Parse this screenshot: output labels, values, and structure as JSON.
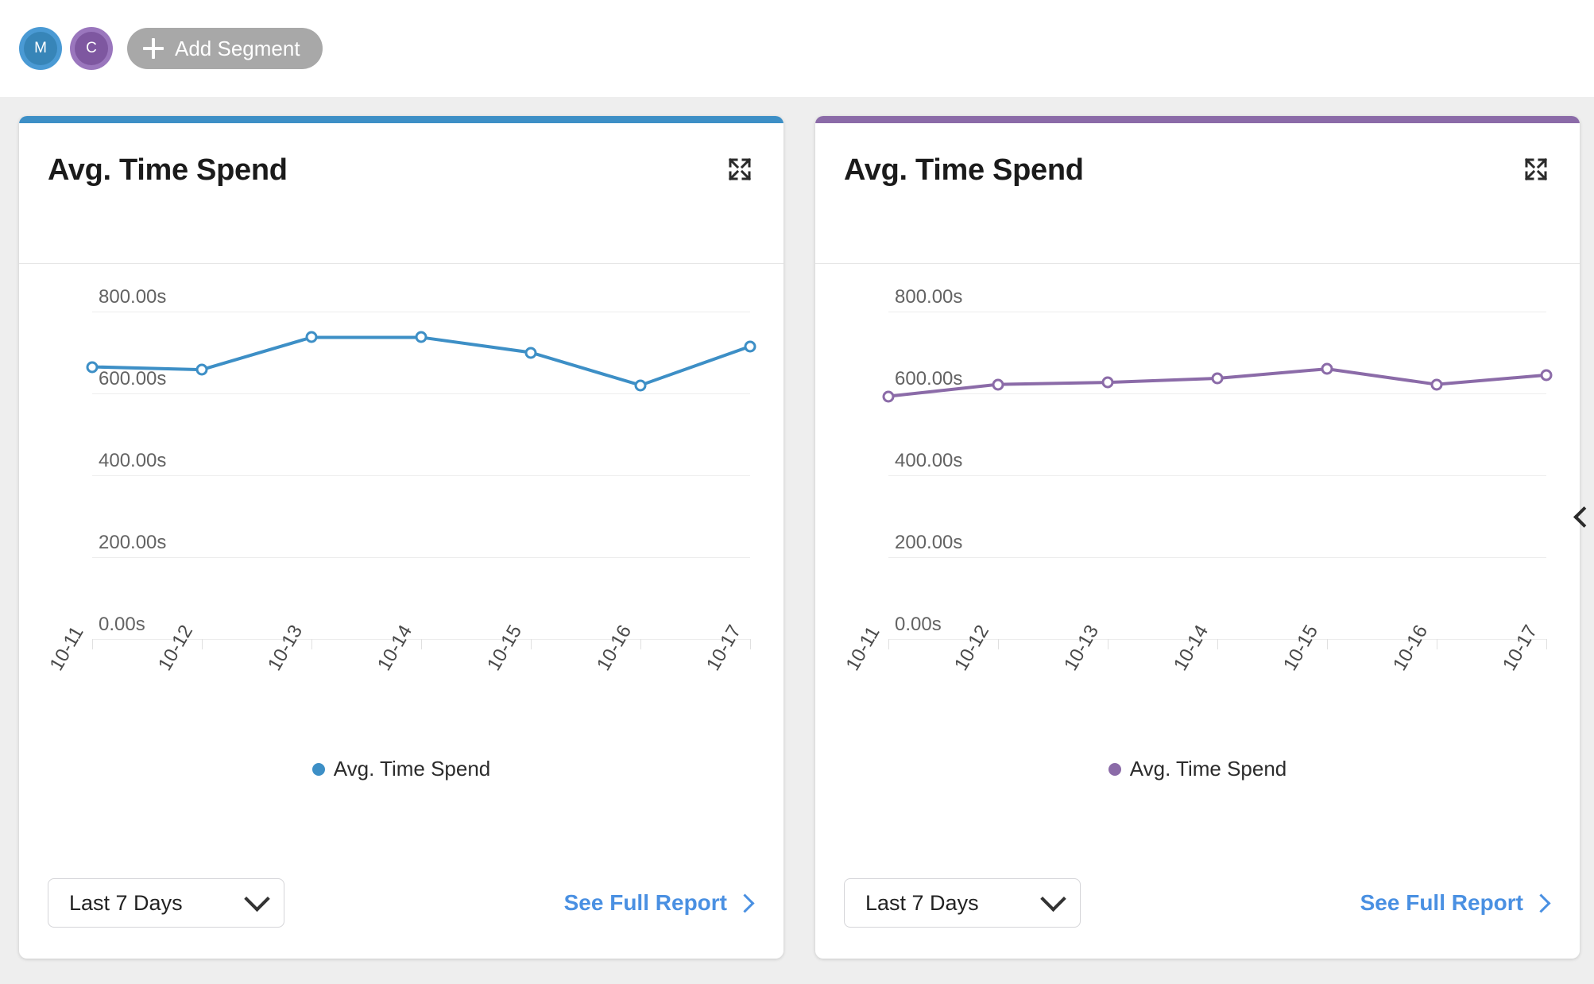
{
  "topbar": {
    "avatars": [
      {
        "initial": "M",
        "name": "avatar-m",
        "color": "#4a9ad4"
      },
      {
        "initial": "C",
        "name": "avatar-c",
        "color": "#9a76bd"
      }
    ],
    "add_segment_label": "Add Segment",
    "plus_icon": "plus-icon"
  },
  "cards": [
    {
      "title": "Avg. Time Spend",
      "accent_color": "#3d8fc6",
      "expand_icon": "expand-icon",
      "range_label": "Last 7 Days",
      "report_label": "See Full Report",
      "legend_label": "Avg. Time Spend"
    },
    {
      "title": "Avg. Time Spend",
      "accent_color": "#8b6ba8",
      "expand_icon": "expand-icon",
      "range_label": "Last 7 Days",
      "report_label": "See Full Report",
      "legend_label": "Avg. Time Spend"
    }
  ],
  "collapse_handle_icon": "chevron-left-icon",
  "chart_data": [
    {
      "type": "line",
      "title": "Avg. Time Spend",
      "series": [
        {
          "name": "Avg. Time Spend",
          "color": "#3d8fc6",
          "values": [
            665,
            658,
            737,
            737,
            700,
            620,
            715
          ]
        }
      ],
      "categories": [
        "10-11",
        "10-12",
        "10-13",
        "10-14",
        "10-15",
        "10-16",
        "10-17"
      ],
      "x": [
        "10-11",
        "10-12",
        "10-13",
        "10-14",
        "10-15",
        "10-16",
        "10-17"
      ],
      "xlabel": "",
      "ylabel": "",
      "ylim": [
        0,
        800
      ],
      "yticks": [
        0,
        200,
        400,
        600,
        800
      ],
      "ytick_labels": [
        "0.00s",
        "200.00s",
        "400.00s",
        "600.00s",
        "800.00s"
      ],
      "grid": true,
      "legend_position": "bottom"
    },
    {
      "type": "line",
      "title": "Avg. Time Spend",
      "series": [
        {
          "name": "Avg. Time Spend",
          "color": "#8b6ba8",
          "values": [
            593,
            622,
            627,
            637,
            660,
            622,
            645
          ]
        }
      ],
      "categories": [
        "10-11",
        "10-12",
        "10-13",
        "10-14",
        "10-15",
        "10-16",
        "10-17"
      ],
      "x": [
        "10-11",
        "10-12",
        "10-13",
        "10-14",
        "10-15",
        "10-16",
        "10-17"
      ],
      "xlabel": "",
      "ylabel": "",
      "ylim": [
        0,
        800
      ],
      "yticks": [
        0,
        200,
        400,
        600,
        800
      ],
      "ytick_labels": [
        "0.00s",
        "200.00s",
        "400.00s",
        "600.00s",
        "800.00s"
      ],
      "grid": true,
      "legend_position": "bottom"
    }
  ]
}
